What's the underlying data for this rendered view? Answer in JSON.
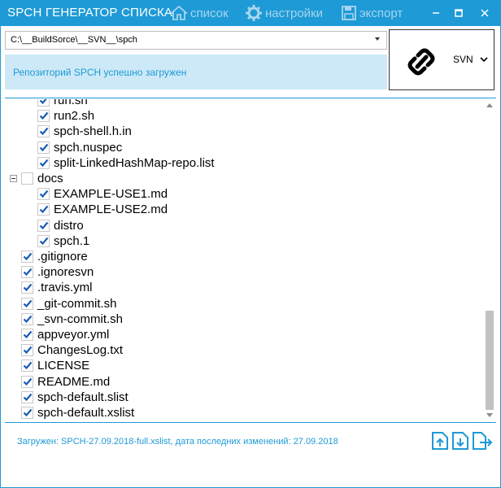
{
  "app": {
    "title": "SPCH ГЕНЕРАТОР СПИСКА",
    "accent_color": "#1e9ad6"
  },
  "menu": {
    "list_label": "список",
    "settings_label": "настройки",
    "export_label": "экспорт"
  },
  "window_controls": {
    "minimize": "—",
    "maximize": "☐",
    "close": "✕"
  },
  "path": {
    "value": "C:\\__BuildSorce\\__SVN__\\spch"
  },
  "status": {
    "message": "Репозиторий SPCH успешно загружен"
  },
  "vcs": {
    "selected": "SVN"
  },
  "tree": {
    "items": [
      {
        "label": "run.sh",
        "checked": true
      },
      {
        "label": "run2.sh",
        "checked": true
      },
      {
        "label": "spch-shell.h.in",
        "checked": true
      },
      {
        "label": "spch.nuspec",
        "checked": true
      },
      {
        "label": "split-LinkedHashMap-repo.list",
        "checked": true
      },
      {
        "label": "docs",
        "checked": false
      },
      {
        "label": "EXAMPLE-USE1.md",
        "checked": true
      },
      {
        "label": "EXAMPLE-USE2.md",
        "checked": true
      },
      {
        "label": "distro",
        "checked": true
      },
      {
        "label": "spch.1",
        "checked": true
      },
      {
        "label": ".gitignore",
        "checked": true
      },
      {
        "label": ".ignoresvn",
        "checked": true
      },
      {
        "label": ".travis.yml",
        "checked": true
      },
      {
        "label": "_git-commit.sh",
        "checked": true
      },
      {
        "label": "_svn-commit.sh",
        "checked": true
      },
      {
        "label": "appveyor.yml",
        "checked": true
      },
      {
        "label": "ChangesLog.txt",
        "checked": true
      },
      {
        "label": "LICENSE",
        "checked": true
      },
      {
        "label": "README.md",
        "checked": true
      },
      {
        "label": "spch-default.slist",
        "checked": true
      },
      {
        "label": "spch-default.xslist",
        "checked": true
      }
    ]
  },
  "footer": {
    "status": "Загружен: SPCH-27.09.2018-full.xslist, дата последних изменений: 27.09.2018"
  },
  "icons": {
    "list": "home-icon",
    "settings": "gear-icon",
    "export": "save-icon",
    "vcs": "link-icon",
    "footer": [
      "upload-icon",
      "download-icon",
      "export-arrow-icon"
    ]
  }
}
